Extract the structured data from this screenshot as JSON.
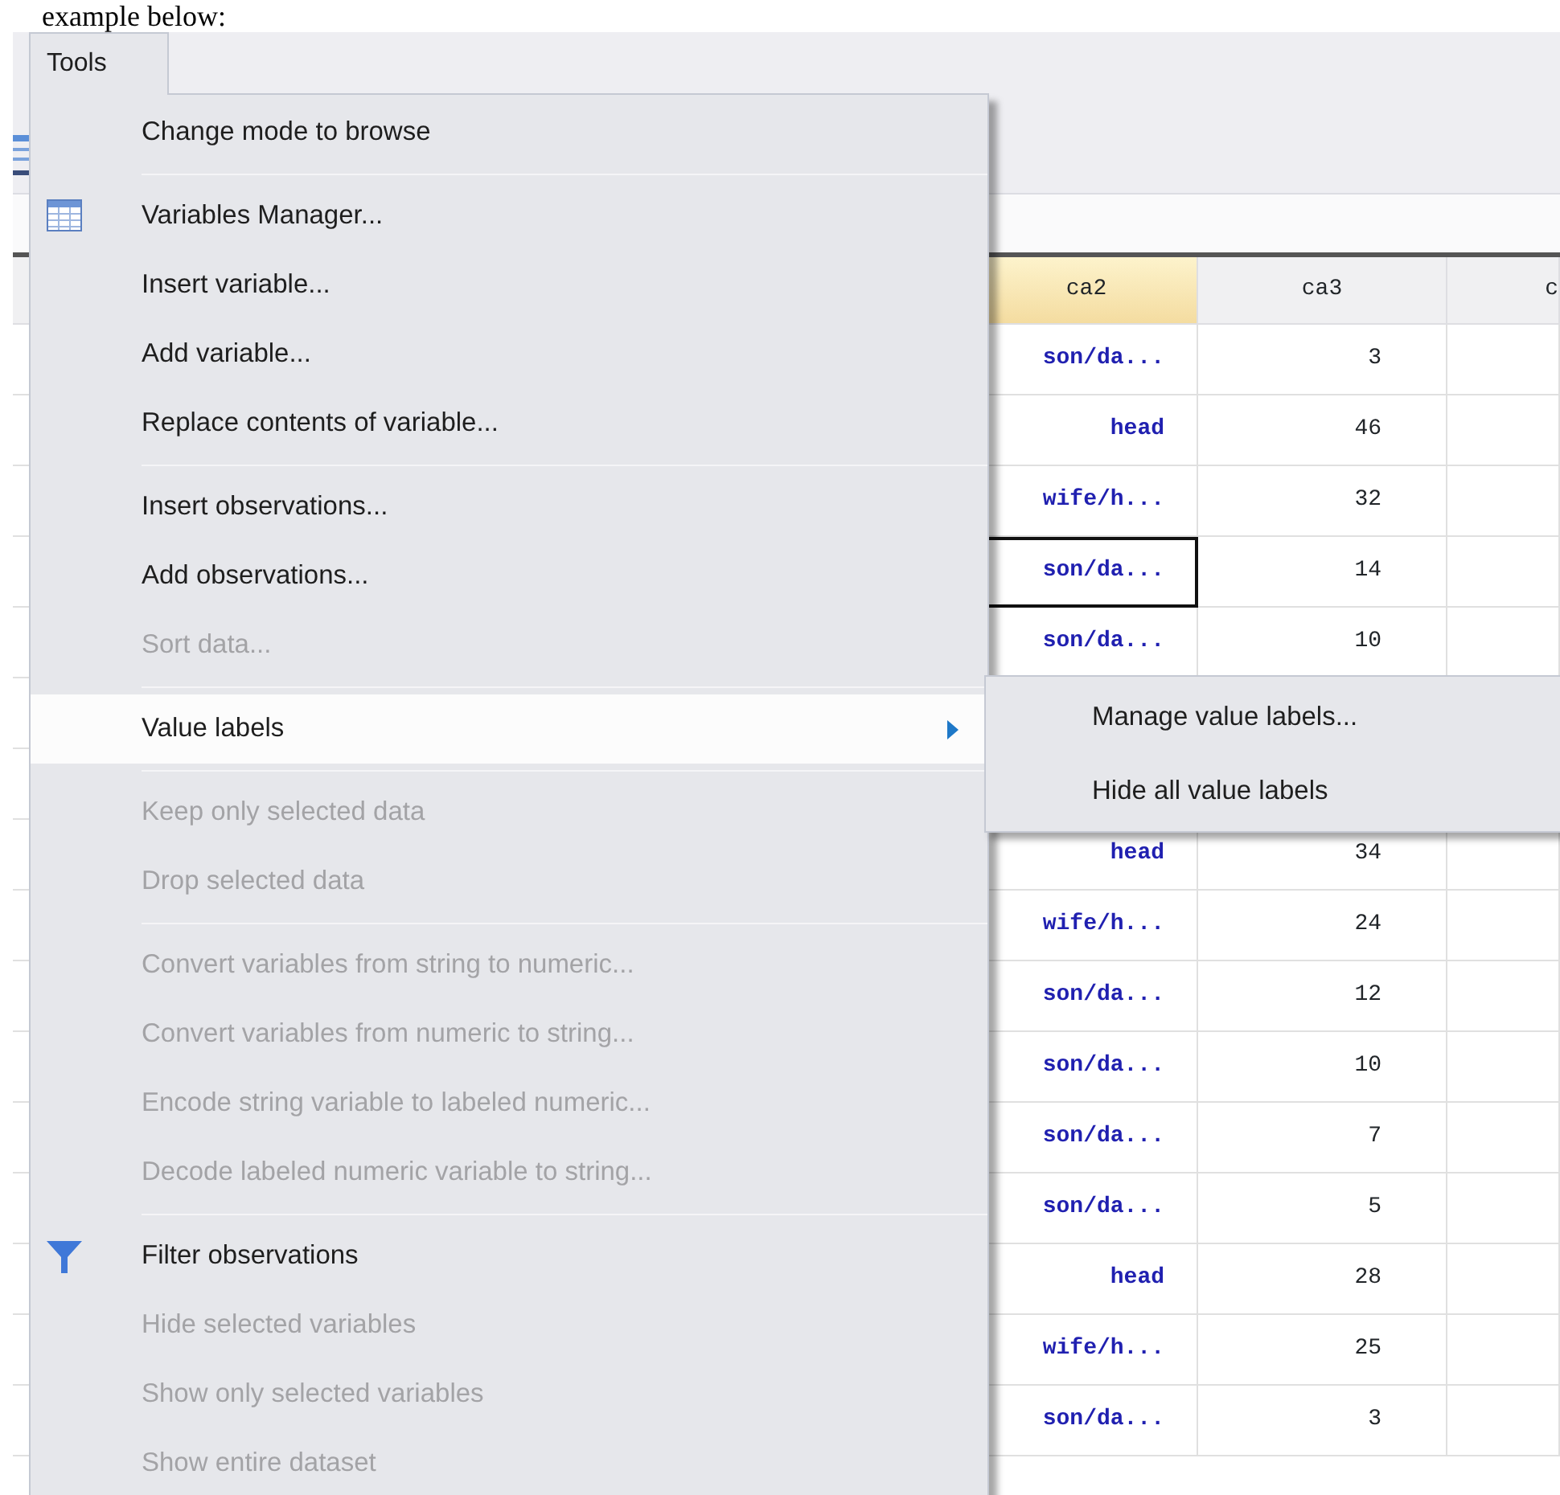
{
  "intro_text": "example below:",
  "menubar": {
    "items": [
      {
        "label": "Tools",
        "selected": true
      }
    ]
  },
  "menu": {
    "items": [
      {
        "kind": "plain",
        "label": "Change mode to browse",
        "disabled": false,
        "selected": false
      },
      {
        "kind": "separator"
      },
      {
        "kind": "table",
        "label": "Variables Manager...",
        "disabled": false,
        "selected": false
      },
      {
        "kind": "plain",
        "label": "Insert variable...",
        "disabled": false,
        "selected": false
      },
      {
        "kind": "plain",
        "label": "Add variable...",
        "disabled": false,
        "selected": false
      },
      {
        "kind": "plain",
        "label": "Replace contents of variable...",
        "disabled": false,
        "selected": false
      },
      {
        "kind": "separator"
      },
      {
        "kind": "plain",
        "label": "Insert observations...",
        "disabled": false,
        "selected": false
      },
      {
        "kind": "plain",
        "label": "Add observations...",
        "disabled": false,
        "selected": false
      },
      {
        "kind": "plain",
        "label": "Sort data...",
        "disabled": true,
        "selected": false
      },
      {
        "kind": "separator"
      },
      {
        "kind": "submenu",
        "label": "Value labels",
        "disabled": false,
        "selected": true
      },
      {
        "kind": "separator"
      },
      {
        "kind": "plain",
        "label": "Keep only selected data",
        "disabled": true,
        "selected": false
      },
      {
        "kind": "plain",
        "label": "Drop selected data",
        "disabled": true,
        "selected": false
      },
      {
        "kind": "separator"
      },
      {
        "kind": "plain",
        "label": "Convert variables from string to numeric...",
        "disabled": true,
        "selected": false
      },
      {
        "kind": "plain",
        "label": "Convert variables from numeric to string...",
        "disabled": true,
        "selected": false
      },
      {
        "kind": "plain",
        "label": "Encode string variable to labeled numeric...",
        "disabled": true,
        "selected": false
      },
      {
        "kind": "plain",
        "label": "Decode labeled numeric variable to string...",
        "disabled": true,
        "selected": false
      },
      {
        "kind": "separator"
      },
      {
        "kind": "filter",
        "label": "Filter observations",
        "disabled": false,
        "selected": false
      },
      {
        "kind": "plain",
        "label": "Hide selected variables",
        "disabled": true,
        "selected": false
      },
      {
        "kind": "plain",
        "label": "Show only selected variables",
        "disabled": true,
        "selected": false
      },
      {
        "kind": "plain",
        "label": "Show entire dataset",
        "disabled": true,
        "selected": false
      }
    ]
  },
  "submenu": {
    "items": [
      {
        "label": "Manage value labels..."
      },
      {
        "label": "Hide all value labels"
      }
    ]
  },
  "grid": {
    "columns": [
      {
        "label": "ca2",
        "selected": true
      },
      {
        "label": "ca3",
        "selected": false
      },
      {
        "label": "c",
        "selected": false
      }
    ],
    "rows": [
      {
        "ca2": "son/da...",
        "ca3": "3",
        "selected": false
      },
      {
        "ca2": "head",
        "ca3": "46",
        "selected": false
      },
      {
        "ca2": "wife/h...",
        "ca3": "32",
        "selected": false
      },
      {
        "ca2": "son/da...",
        "ca3": "14",
        "selected": true
      },
      {
        "ca2": "son/da...",
        "ca3": "10",
        "selected": false
      },
      {
        "ca2": "head",
        "ca3": "34",
        "selected": false
      },
      {
        "ca2": "wife/h...",
        "ca3": "24",
        "selected": false
      },
      {
        "ca2": "son/da...",
        "ca3": "12",
        "selected": false
      },
      {
        "ca2": "son/da...",
        "ca3": "10",
        "selected": false
      },
      {
        "ca2": "son/da...",
        "ca3": "7",
        "selected": false
      },
      {
        "ca2": "son/da...",
        "ca3": "5",
        "selected": false
      },
      {
        "ca2": "head",
        "ca3": "28",
        "selected": false
      },
      {
        "ca2": "wife/h...",
        "ca3": "25",
        "selected": false
      },
      {
        "ca2": "son/da...",
        "ca3": "3",
        "selected": false
      }
    ]
  }
}
